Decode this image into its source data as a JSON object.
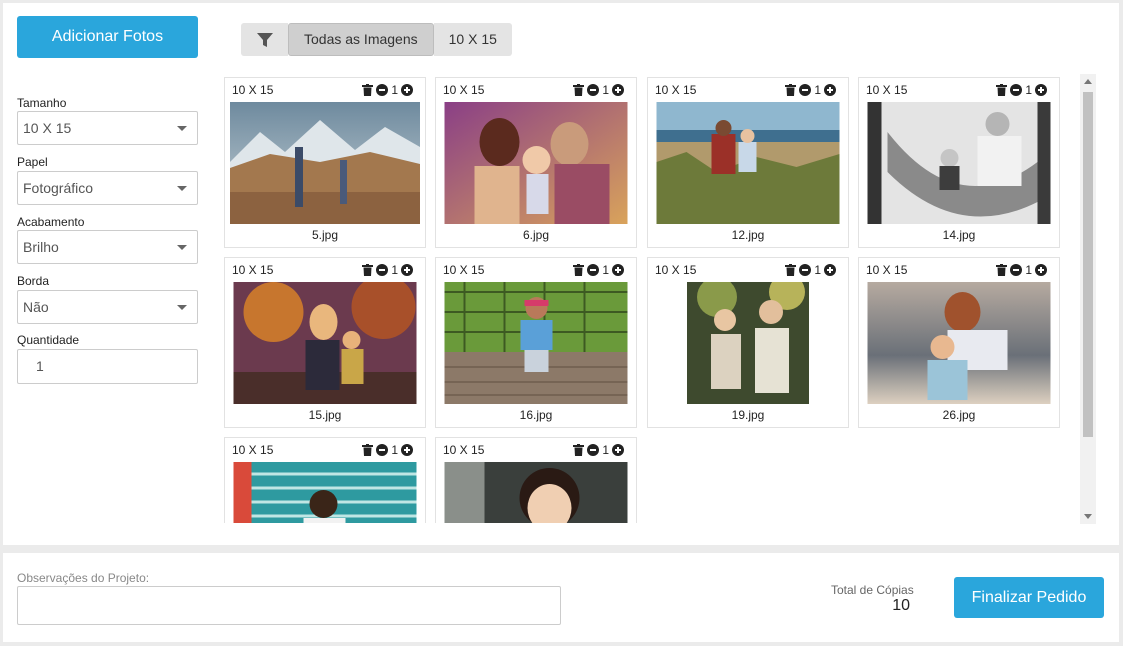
{
  "toolbar": {
    "add_photos_label": "Adicionar Fotos"
  },
  "filters": {
    "icon": "filter-icon",
    "all_images_label": "Todas as Imagens",
    "size_filter_label": "10 X 15"
  },
  "options": {
    "tamanho": {
      "label": "Tamanho",
      "value": "10 X 15"
    },
    "papel": {
      "label": "Papel",
      "value": "Fotográfico"
    },
    "acabamento": {
      "label": "Acabamento",
      "value": "Brilho"
    },
    "borda": {
      "label": "Borda",
      "value": "Não"
    },
    "quantidade": {
      "label": "Quantidade",
      "value": "1"
    }
  },
  "photos": [
    {
      "size": "10 X 15",
      "qty": "1",
      "name": "5.jpg"
    },
    {
      "size": "10 X 15",
      "qty": "1",
      "name": "6.jpg"
    },
    {
      "size": "10 X 15",
      "qty": "1",
      "name": "12.jpg"
    },
    {
      "size": "10 X 15",
      "qty": "1",
      "name": "14.jpg"
    },
    {
      "size": "10 X 15",
      "qty": "1",
      "name": "15.jpg"
    },
    {
      "size": "10 X 15",
      "qty": "1",
      "name": "16.jpg"
    },
    {
      "size": "10 X 15",
      "qty": "1",
      "name": "19.jpg"
    },
    {
      "size": "10 X 15",
      "qty": "1",
      "name": "26.jpg"
    },
    {
      "size": "10 X 15",
      "qty": "1",
      "name": ""
    },
    {
      "size": "10 X 15",
      "qty": "1",
      "name": ""
    }
  ],
  "footer": {
    "notes_label": "Observações do Projeto:",
    "notes_value": "",
    "total_label": "Total de Cópias",
    "total_value": "10",
    "finish_label": "Finalizar Pedido"
  },
  "colors": {
    "accent": "#2aa6dc"
  }
}
